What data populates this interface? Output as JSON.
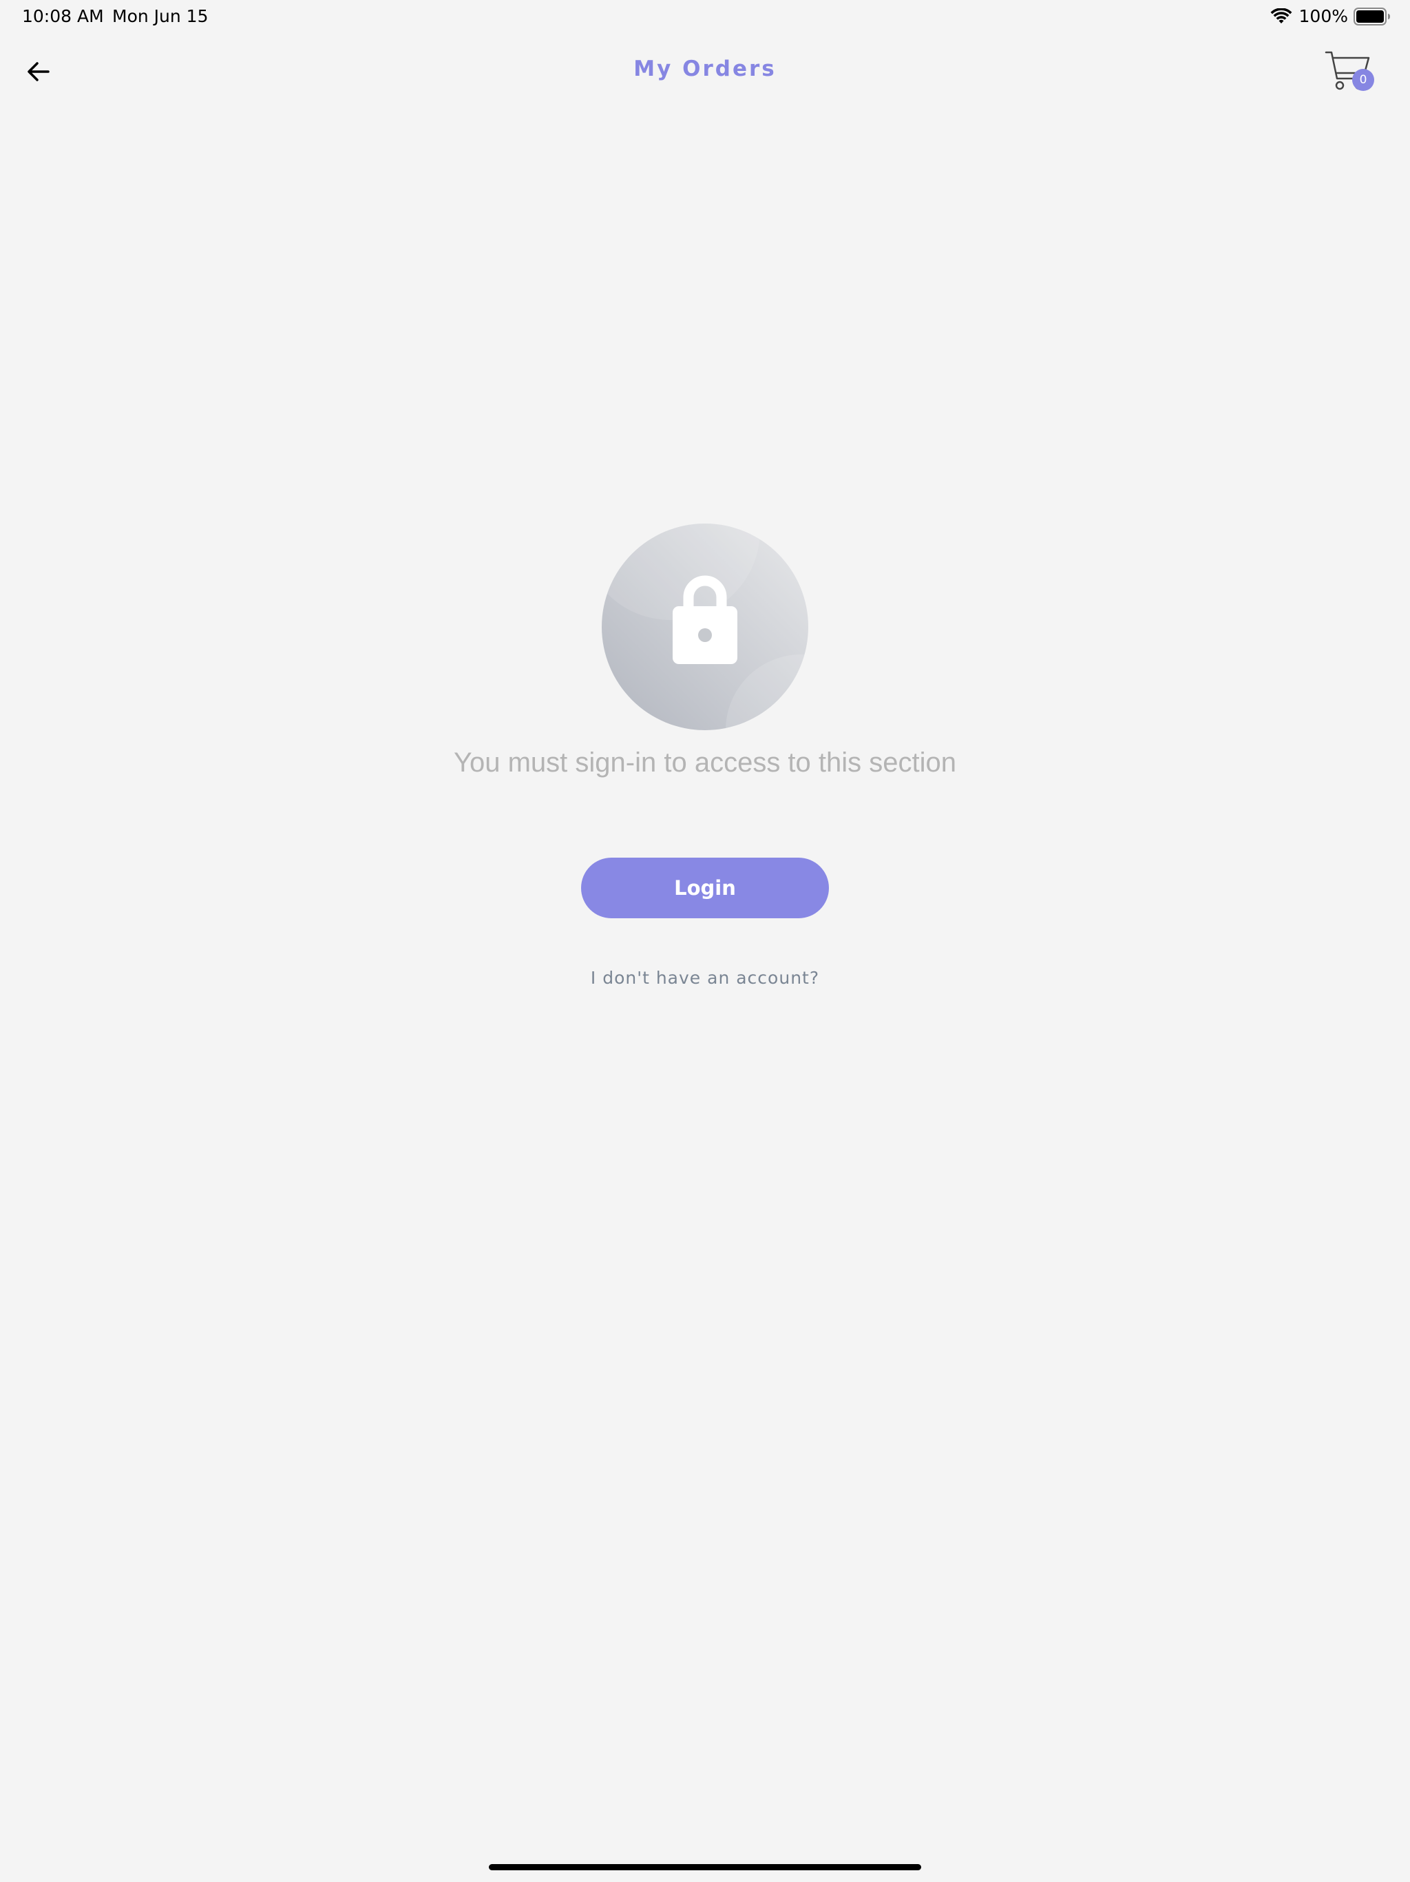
{
  "status_bar": {
    "time": "10:08 AM",
    "date": "Mon Jun 15",
    "battery_percent": "100%",
    "wifi_icon": "wifi-icon",
    "battery_icon": "battery-full-icon"
  },
  "nav": {
    "back_icon": "arrow-left-icon",
    "title": "My Orders",
    "cart_icon": "shopping-cart-icon",
    "cart_count": "0"
  },
  "content": {
    "illustration_icon": "lock-icon",
    "message": "You must sign-in to access to this section",
    "login_label": "Login",
    "no_account_label": "I don't have an account?"
  },
  "colors": {
    "accent": "#8686e2",
    "background": "#f4f4f4",
    "message_text": "#b4b4b4",
    "link_text": "#7a8593"
  }
}
